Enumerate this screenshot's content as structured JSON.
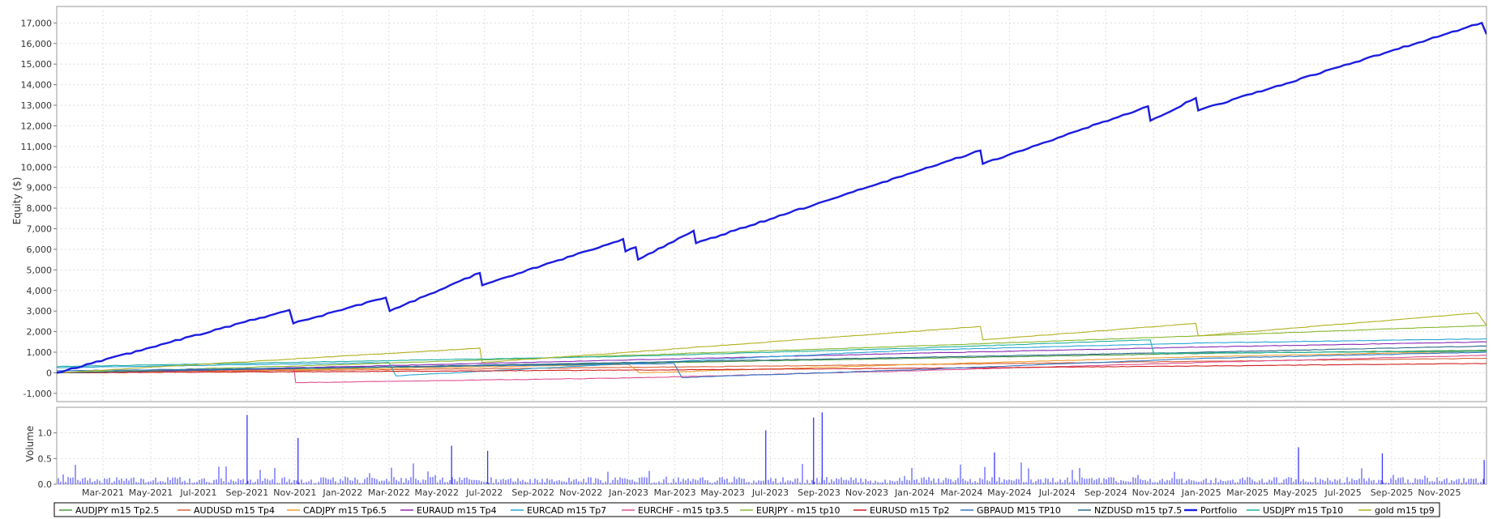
{
  "chart_data": [
    {
      "type": "line",
      "ylabel": "Equity ($)",
      "xlim": [
        "2021-01-01",
        "2025-12-31"
      ],
      "ylim": [
        -1400,
        17800
      ],
      "yticks": [
        -1000,
        0,
        1000,
        2000,
        3000,
        4000,
        5000,
        6000,
        7000,
        8000,
        9000,
        10000,
        11000,
        12000,
        13000,
        14000,
        15000,
        16000,
        17000
      ],
      "ytick_labels": [
        "-1,000",
        "0",
        "1,000",
        "2,000",
        "3,000",
        "4,000",
        "5,000",
        "6,000",
        "7,000",
        "8,000",
        "9,000",
        "10,000",
        "11,000",
        "12,000",
        "13,000",
        "14,000",
        "15,000",
        "16,000",
        "17,000"
      ],
      "grid": true,
      "series": [
        {
          "name": "AUDJPY m15 Tp2.5",
          "color": "#4f9a3c",
          "x": [
            "2021-01-01",
            "2022-01-01",
            "2023-01-01",
            "2024-01-01",
            "2025-01-01",
            "2025-12-31"
          ],
          "values": [
            0,
            230,
            470,
            700,
            940,
            1100
          ]
        },
        {
          "name": "AUDUSD m15 Tp4",
          "color": "#d9623b",
          "x": [
            "2021-01-01",
            "2022-01-01",
            "2023-01-01",
            "2024-01-01",
            "2025-01-01",
            "2025-12-31"
          ],
          "values": [
            0,
            130,
            260,
            400,
            560,
            700
          ]
        },
        {
          "name": "CADJPY m15 Tp6.5",
          "color": "#f0a030",
          "x": [
            "2021-01-01",
            "2022-01-01",
            "2023-01-01",
            "2023-01-15",
            "2024-01-01",
            "2025-01-01",
            "2025-12-31"
          ],
          "values": [
            0,
            180,
            400,
            0,
            400,
            780,
            1050
          ]
        },
        {
          "name": "EURAUD m15 Tp4",
          "color": "#8a2bb5",
          "x": [
            "2021-01-01",
            "2022-01-01",
            "2023-01-01",
            "2024-01-01",
            "2025-01-01",
            "2025-12-31"
          ],
          "values": [
            0,
            300,
            620,
            950,
            1250,
            1500
          ]
        },
        {
          "name": "EURCAD m15 Tp7",
          "color": "#2aa6d6",
          "x": [
            "2021-01-01",
            "2022-03-01",
            "2022-03-10",
            "2023-01-01",
            "2024-01-01",
            "2025-01-01",
            "2025-12-31"
          ],
          "values": [
            250,
            500,
            -150,
            450,
            1100,
            1450,
            1650
          ]
        },
        {
          "name": "EURCHF - m15 tp3.5",
          "color": "#e05090",
          "x": [
            "2021-01-01",
            "2021-10-31",
            "2021-11-02",
            "2023-01-01",
            "2024-01-01",
            "2025-01-01",
            "2025-12-31"
          ],
          "values": [
            0,
            180,
            -480,
            -250,
            100,
            500,
            850
          ]
        },
        {
          "name": "EURJPY - m15 tp10",
          "color": "#8ab832",
          "x": [
            "2021-01-01",
            "2022-01-01",
            "2023-01-01",
            "2024-01-01",
            "2025-01-01",
            "2025-12-31"
          ],
          "values": [
            0,
            400,
            850,
            1300,
            1800,
            2300
          ]
        },
        {
          "name": "EURUSD m15 Tp2",
          "color": "#d02020",
          "x": [
            "2021-01-01",
            "2022-01-01",
            "2023-01-01",
            "2024-01-01",
            "2025-01-01",
            "2025-12-31"
          ],
          "values": [
            0,
            60,
            130,
            220,
            330,
            450
          ]
        },
        {
          "name": "GBPAUD M15 TP10",
          "color": "#3078c8",
          "x": [
            "2021-01-01",
            "2022-01-01",
            "2023-02-28",
            "2023-03-10",
            "2024-01-01",
            "2025-01-01",
            "2025-12-31"
          ],
          "values": [
            100,
            250,
            450,
            -230,
            150,
            700,
            1000
          ]
        },
        {
          "name": "NZDUSD m15 tp7.5",
          "color": "#2c6a8c",
          "x": [
            "2021-01-01",
            "2022-01-01",
            "2023-01-01",
            "2024-01-01",
            "2025-01-01",
            "2025-12-31"
          ],
          "values": [
            0,
            250,
            500,
            750,
            1000,
            1300
          ]
        },
        {
          "name": "Portfolio",
          "color": "#1c1ce0",
          "x": [
            "2021-01-01",
            "2021-10-25",
            "2021-10-30",
            "2022-02-25",
            "2022-03-02",
            "2022-06-25",
            "2022-06-28",
            "2022-12-25",
            "2022-12-28",
            "2023-01-10",
            "2023-01-13",
            "2023-03-25",
            "2023-03-28",
            "2024-03-25",
            "2024-03-28",
            "2024-10-25",
            "2024-10-28",
            "2024-12-25",
            "2024-12-28",
            "2025-12-25",
            "2025-12-31"
          ],
          "values": [
            0,
            3050,
            2400,
            3650,
            3000,
            4850,
            4250,
            6500,
            5900,
            6100,
            5500,
            6900,
            6300,
            10800,
            10150,
            12950,
            12250,
            13350,
            12750,
            17000,
            16450
          ]
        },
        {
          "name": "USDJPY m15 Tp10",
          "color": "#20b0a0",
          "x": [
            "2021-01-01",
            "2022-01-01",
            "2023-01-01",
            "2024-01-01",
            "2024-10-28",
            "2024-11-01",
            "2025-12-31"
          ],
          "values": [
            300,
            550,
            800,
            1200,
            1600,
            950,
            1050
          ]
        },
        {
          "name": "gold m15 tp9",
          "color": "#b0b020",
          "x": [
            "2021-01-01",
            "2022-06-25",
            "2022-06-28",
            "2023-01-01",
            "2024-03-25",
            "2024-03-28",
            "2024-12-25",
            "2024-12-28",
            "2025-12-20",
            "2025-12-31"
          ],
          "values": [
            0,
            1200,
            500,
            1000,
            2250,
            1600,
            2400,
            1800,
            2900,
            2300
          ]
        }
      ]
    },
    {
      "type": "bar",
      "ylabel": "Volume",
      "ylim": [
        0,
        1.5
      ],
      "yticks": [
        0,
        0.5,
        1
      ],
      "ytick_labels": [
        "0.0",
        "0.5",
        "1.0"
      ],
      "color": "#3636ff",
      "grid": true,
      "x": [
        "2021-09-01",
        "2021-11-05",
        "2022-05-20",
        "2022-07-05",
        "2023-06-25",
        "2023-08-25",
        "2023-09-05",
        "2024-04-12",
        "2025-05-05",
        "2025-08-20",
        "2025-12-28"
      ],
      "values": [
        1.35,
        0.9,
        0.75,
        0.65,
        1.05,
        1.3,
        1.4,
        0.62,
        0.72,
        0.6,
        0.47
      ],
      "xtick_labels": [
        "Mar-2021",
        "May-2021",
        "Jul-2021",
        "Sep-2021",
        "Nov-2021",
        "Jan-2022",
        "Mar-2022",
        "May-2022",
        "Jul-2022",
        "Sep-2022",
        "Nov-2022",
        "Jan-2023",
        "Mar-2023",
        "May-2023",
        "Jul-2023",
        "Sep-2023",
        "Nov-2023",
        "Jan-2024",
        "Mar-2024",
        "May-2024",
        "Jul-2024",
        "Sep-2024",
        "Nov-2024",
        "Jan-2025",
        "Mar-2025",
        "May-2025",
        "Jul-2025",
        "Sep-2025",
        "Nov-2025"
      ],
      "xtick_dates": [
        "2021-03-01",
        "2021-05-01",
        "2021-07-01",
        "2021-09-01",
        "2021-11-01",
        "2022-01-01",
        "2022-03-01",
        "2022-05-01",
        "2022-07-01",
        "2022-09-01",
        "2022-11-01",
        "2023-01-01",
        "2023-03-01",
        "2023-05-01",
        "2023-07-01",
        "2023-09-01",
        "2023-11-01",
        "2024-01-01",
        "2024-03-01",
        "2024-05-01",
        "2024-07-01",
        "2024-09-01",
        "2024-11-01",
        "2025-01-01",
        "2025-03-01",
        "2025-05-01",
        "2025-07-01",
        "2025-09-01",
        "2025-11-01"
      ]
    }
  ]
}
